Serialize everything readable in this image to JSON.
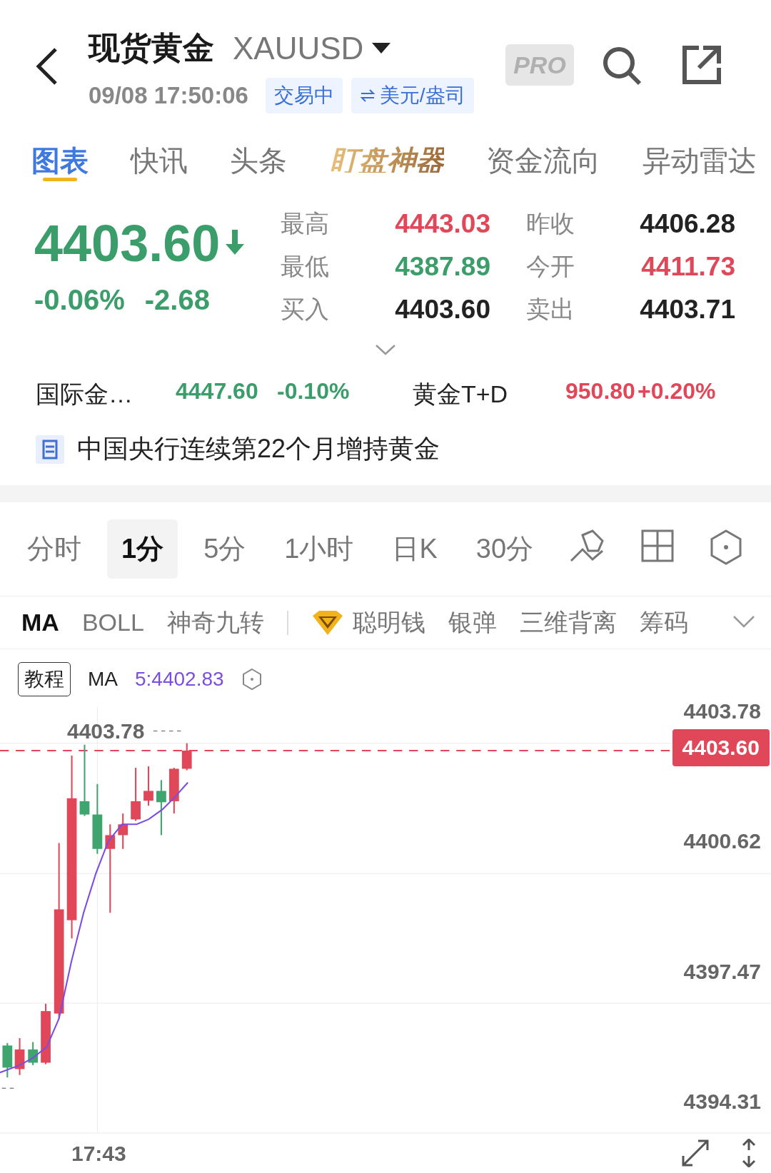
{
  "header": {
    "title": "现货黄金",
    "symbol": "XAUUSD",
    "time": "09/08 17:50:06",
    "pro_badge": "PRO",
    "badges": [
      {
        "text": "交易中",
        "kind": "status"
      },
      {
        "text": "美元/盎司",
        "kind": "unit"
      }
    ]
  },
  "tabs": [
    {
      "label": "图表",
      "selected": true,
      "kind": "plain"
    },
    {
      "label": "快讯",
      "selected": false,
      "kind": "plain"
    },
    {
      "label": "头条",
      "selected": false,
      "kind": "plain"
    },
    {
      "label": "盯盘神器",
      "selected": false,
      "kind": "special"
    },
    {
      "label": "资金流向",
      "selected": false,
      "kind": "plain"
    },
    {
      "label": "异动雷达",
      "selected": false,
      "kind": "plain"
    }
  ],
  "quote": {
    "price": "4403.60",
    "color": "#3a9d6a",
    "change_pct": "-0.06%",
    "change": "-2.68",
    "stats": [
      {
        "label": "最高",
        "value": "4443.03",
        "color": "#e0485a"
      },
      {
        "label": "昨收",
        "value": "4406.28",
        "color": "#222222"
      },
      {
        "label": "最低",
        "value": "4387.89",
        "color": "#3a9d6a"
      },
      {
        "label": "今开",
        "value": "4411.73",
        "color": "#e0485a"
      },
      {
        "label": "买入",
        "value": "4403.60",
        "color": "#222222"
      },
      {
        "label": "卖出",
        "value": "4403.71",
        "color": "#222222"
      }
    ]
  },
  "related": [
    {
      "name": "国际金…",
      "price": "4447.60",
      "change": "-0.10%",
      "color": "#3a9d6a"
    },
    {
      "name": "黄金T+D",
      "price": "950.80",
      "change": "+0.20%",
      "color": "#e0485a"
    }
  ],
  "news": {
    "text": "中国央行连续第22个月增持黄金"
  },
  "periods": [
    {
      "label": "分时",
      "selected": false
    },
    {
      "label": "1分",
      "selected": true
    },
    {
      "label": "5分",
      "selected": false
    },
    {
      "label": "1小时",
      "selected": false
    },
    {
      "label": "日K",
      "selected": false
    },
    {
      "label": "30分",
      "selected": false
    }
  ],
  "indicators": [
    {
      "label": "MA",
      "selected": true,
      "kind": "plain"
    },
    {
      "label": "BOLL",
      "selected": false,
      "kind": "plain"
    },
    {
      "label": "神奇九转",
      "selected": false,
      "kind": "plain"
    },
    {
      "label": "聪明钱",
      "selected": false,
      "kind": "premium"
    },
    {
      "label": "银弹",
      "selected": false,
      "kind": "plain"
    },
    {
      "label": "三维背离",
      "selected": false,
      "kind": "plain"
    },
    {
      "label": "筹码",
      "selected": false,
      "kind": "plain"
    }
  ],
  "chart": {
    "tutorial_button": "教程",
    "ma_label": "MA",
    "ma_value": "5:4402.83",
    "high_label": "4403.78",
    "last_price": "4403.60",
    "price_axis": [
      "4403.78",
      "4400.62",
      "4397.47",
      "4394.31"
    ],
    "time_axis": [
      "17:43"
    ]
  }
}
